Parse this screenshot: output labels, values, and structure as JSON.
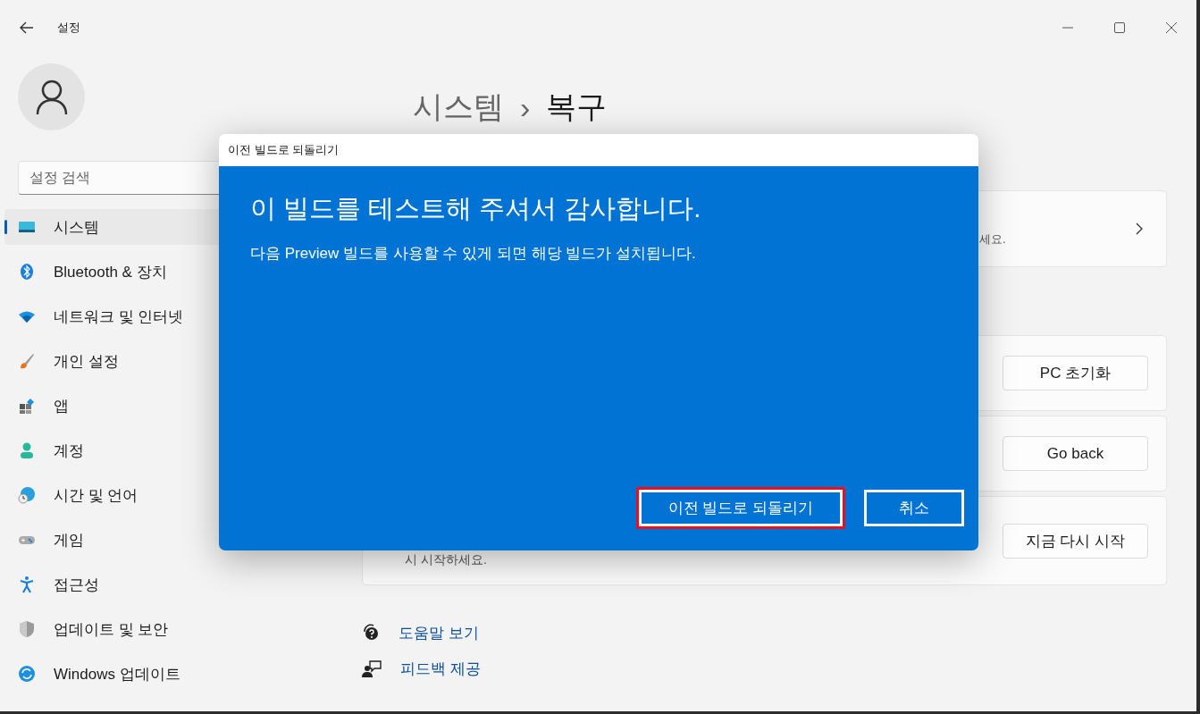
{
  "window": {
    "title": "설정"
  },
  "search": {
    "placeholder": "설정 검색"
  },
  "sidebar": {
    "items": [
      {
        "label": "시스템",
        "selected": true,
        "kind": "system"
      },
      {
        "label": "Bluetooth & 장치",
        "selected": false,
        "kind": "bluetooth"
      },
      {
        "label": "네트워크 및 인터넷",
        "selected": false,
        "kind": "network"
      },
      {
        "label": "개인 설정",
        "selected": false,
        "kind": "personalize"
      },
      {
        "label": "앱",
        "selected": false,
        "kind": "apps"
      },
      {
        "label": "계정",
        "selected": false,
        "kind": "accounts"
      },
      {
        "label": "시간 및 언어",
        "selected": false,
        "kind": "time"
      },
      {
        "label": "게임",
        "selected": false,
        "kind": "gaming"
      },
      {
        "label": "접근성",
        "selected": false,
        "kind": "accessibility"
      },
      {
        "label": "업데이트 및 보안",
        "selected": false,
        "kind": "security"
      },
      {
        "label": "Windows 업데이트",
        "selected": false,
        "kind": "update"
      }
    ]
  },
  "breadcrumb": {
    "parent": "시스템",
    "separator": "›",
    "current": "복구"
  },
  "cards": [
    {
      "kind": "link",
      "text": "세요."
    },
    {
      "kind": "button",
      "button": "PC 초기화"
    },
    {
      "kind": "button",
      "button": "Go back"
    },
    {
      "kind": "button",
      "button": "지금 다시 시작",
      "text": "시 시작하세요."
    }
  ],
  "help_links": [
    {
      "label": "도움말 보기",
      "kind": "help"
    },
    {
      "label": "피드백 제공",
      "kind": "feedback"
    }
  ],
  "dialog": {
    "title": "이전 빌드로 되돌리기",
    "heading": "이 빌드를 테스트해 주셔서 감사합니다.",
    "message": "다음 Preview 빌드를 사용할 수 있게 되면 해당 빌드가 설치됩니다.",
    "buttons": [
      {
        "label": "이전 빌드로 되돌리기",
        "highlighted": true
      },
      {
        "label": "취소",
        "highlighted": false
      }
    ]
  }
}
